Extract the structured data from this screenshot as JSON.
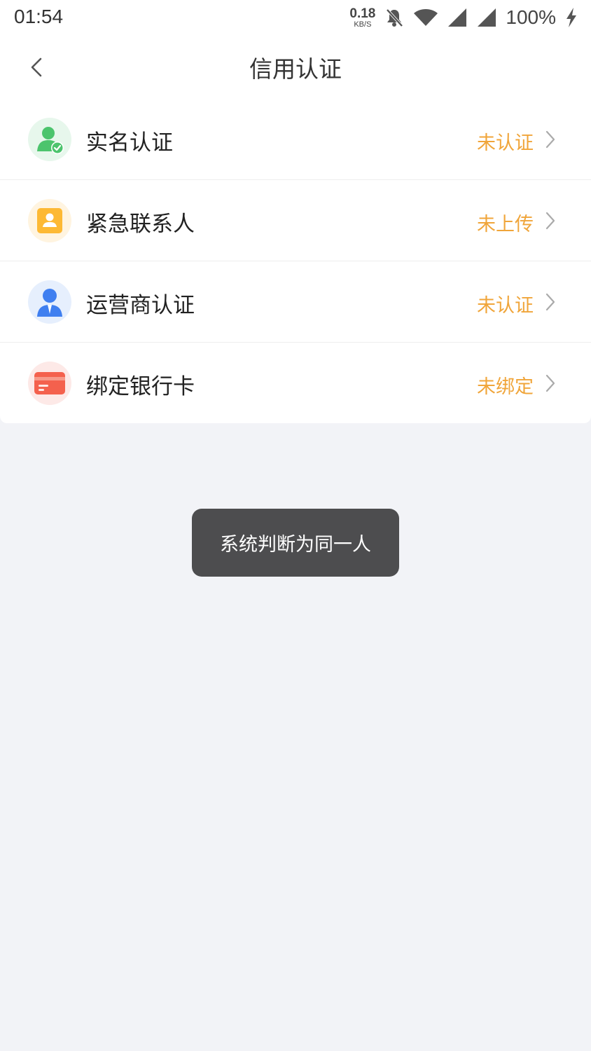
{
  "status_bar": {
    "time": "01:54",
    "net_speed_value": "0.18",
    "net_speed_unit": "KB/S",
    "battery": "100%",
    "icons": [
      "bell-muted-icon",
      "wifi-icon",
      "signal-icon",
      "signal-icon",
      "charging-icon"
    ]
  },
  "header": {
    "title": "信用认证",
    "back_icon": "chevron-left-icon"
  },
  "items": [
    {
      "label": "实名认证",
      "status": "未认证",
      "icon": "user-verified-icon",
      "icon_bg": "#e7f7ec",
      "icon_color": "#4cc46d"
    },
    {
      "label": "紧急联系人",
      "status": "未上传",
      "icon": "contact-card-icon",
      "icon_bg": "#fff4e0",
      "icon_color": "#fdb934"
    },
    {
      "label": "运营商认证",
      "status": "未认证",
      "icon": "operator-person-icon",
      "icon_bg": "#e6effd",
      "icon_color": "#3f7ff0"
    },
    {
      "label": "绑定银行卡",
      "status": "未绑定",
      "icon": "bank-card-icon",
      "icon_bg": "#fde9e7",
      "icon_color": "#f4614d"
    }
  ],
  "toast": {
    "message": "系统判断为同一人"
  },
  "colors": {
    "accent_status": "#f0a53a",
    "background": "#f2f3f7",
    "toast_bg": "#4d4d4f"
  }
}
